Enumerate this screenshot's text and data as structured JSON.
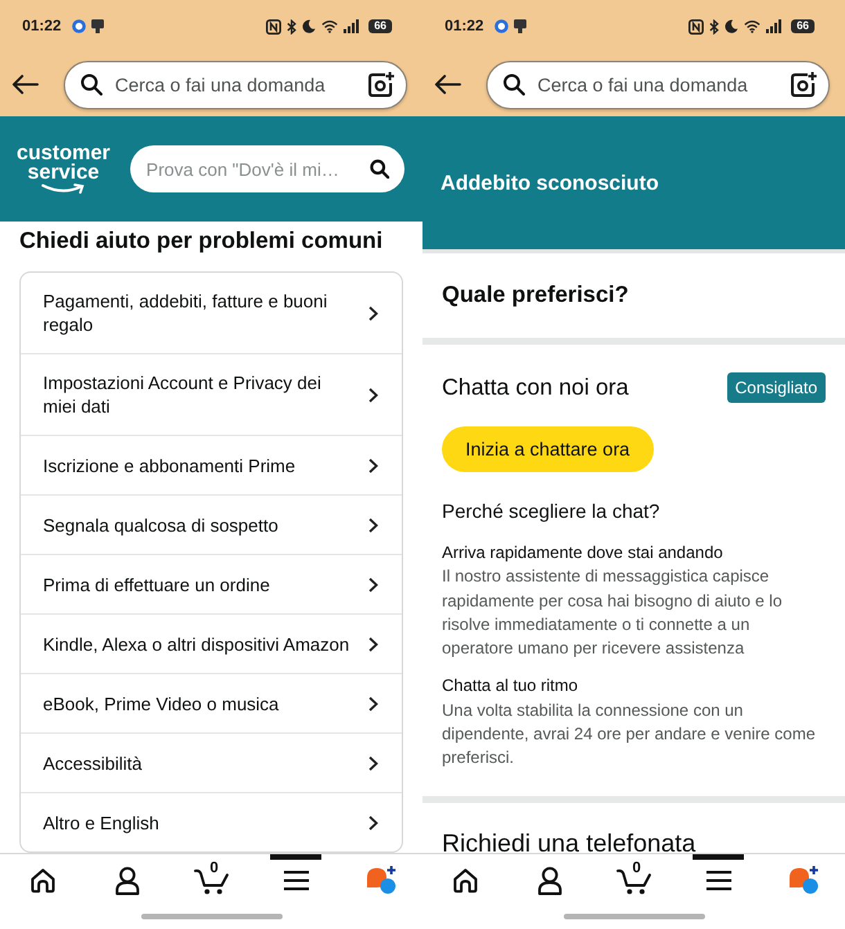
{
  "screens": [
    {
      "kind": "help_topics",
      "status_bar": {
        "time": "01:22",
        "battery": "66"
      },
      "search": {
        "placeholder": "Cerca o fai una domanda"
      },
      "banner": {
        "logo": [
          "customer",
          "service"
        ],
        "search": {
          "placeholder": "Prova con \"Dov'è il mi…"
        }
      },
      "heading": "Chiedi aiuto per problemi comuni",
      "topics": [
        "Pagamenti, addebiti, fatture e buoni regalo",
        "Impostazioni Account e Privacy dei miei dati",
        "Iscrizione e abbonamenti Prime",
        "Segnala qualcosa di sospetto",
        "Prima di effettuare un ordine",
        "Kindle, Alexa o altri dispositivi Amazon",
        "eBook, Prime Video o musica",
        "Accessibilità",
        "Altro e English"
      ],
      "nav": [
        {
          "kind": "home",
          "selected": false
        },
        {
          "kind": "account",
          "selected": false
        },
        {
          "kind": "cart",
          "count": "0",
          "selected": false
        },
        {
          "kind": "menu",
          "selected": true
        },
        {
          "kind": "assistant",
          "selected": false
        }
      ]
    },
    {
      "kind": "contact_options",
      "status_bar": {
        "time": "01:22",
        "battery": "66"
      },
      "search": {
        "placeholder": "Cerca o fai una domanda"
      },
      "banner": {
        "title": "Addebito sconosciuto"
      },
      "heading": "Quale preferisci?",
      "options": [
        {
          "title": "Chatta con noi ora",
          "badge": "Consigliato",
          "button": "Inizia a chattare ora",
          "subheading": "Perché scegliere la chat?",
          "reasons": [
            {
              "title": "Arriva rapidamente dove stai andando",
              "text": "Il nostro assistente di messaggistica capisce rapidamente per cosa hai bisogno di aiuto e lo risolve immediatamente o ti connette a un operatore umano per ricevere assistenza"
            },
            {
              "title": "Chatta al tuo ritmo",
              "text": "Una volta stabilita la connessione con un dipendente, avrai 24 ore per andare e venire come preferisci."
            }
          ]
        },
        {
          "title": "Richiedi una telefonata"
        }
      ],
      "nav": [
        {
          "kind": "home",
          "selected": false
        },
        {
          "kind": "account",
          "selected": false
        },
        {
          "kind": "cart",
          "count": "0",
          "selected": false
        },
        {
          "kind": "menu",
          "selected": true
        },
        {
          "kind": "assistant",
          "selected": false
        }
      ]
    }
  ]
}
